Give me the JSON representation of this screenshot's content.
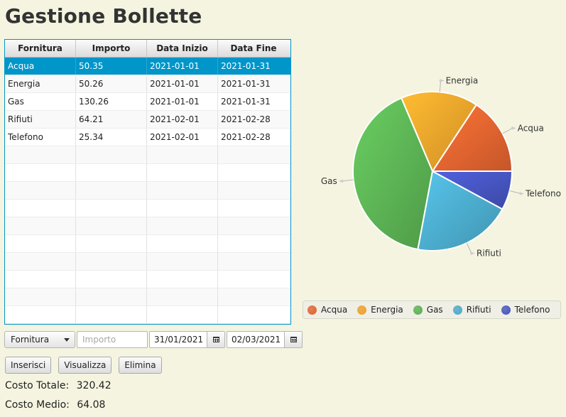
{
  "page": {
    "title": "Gestione Bollette"
  },
  "table": {
    "columns": [
      "Fornitura",
      "Importo",
      "Data Inizio",
      "Data Fine"
    ],
    "rows": [
      [
        "Acqua",
        "50.35",
        "2021-01-01",
        "2021-01-31"
      ],
      [
        "Energia",
        "50.26",
        "2021-01-01",
        "2021-01-31"
      ],
      [
        "Gas",
        "130.26",
        "2021-01-01",
        "2021-01-31"
      ],
      [
        "Rifiuti",
        "64.21",
        "2021-02-01",
        "2021-02-28"
      ],
      [
        "Telefono",
        "25.34",
        "2021-02-01",
        "2021-02-28"
      ]
    ],
    "selected_row": 0,
    "empty_rows": 11
  },
  "chart_data": {
    "type": "pie",
    "slices": [
      {
        "label": "Acqua",
        "value": 50.35,
        "color": "#e0622f"
      },
      {
        "label": "Energia",
        "value": 50.26,
        "color": "#eca02a"
      },
      {
        "label": "Gas",
        "value": 130.26,
        "color": "#5aaf52"
      },
      {
        "label": "Rifiuti",
        "value": 64.21,
        "color": "#4aa8c8"
      },
      {
        "label": "Telefono",
        "value": 25.34,
        "color": "#4453bc"
      }
    ],
    "legend": "bottom",
    "legend_entries": [
      "Acqua",
      "Energia",
      "Gas",
      "Rifiuti",
      "Telefono"
    ]
  },
  "form": {
    "combo_label": "Fornitura",
    "importo_placeholder": "Importo",
    "start_date": "31/01/2021",
    "end_date": "02/03/2021"
  },
  "buttons": {
    "insert": "Inserisci",
    "view": "Visualizza",
    "delete": "Elimina"
  },
  "stats": {
    "total_label": "Costo Totale:",
    "total_value": "320.42",
    "avg_label": "Costo Medio:",
    "avg_value": "64.08"
  },
  "icons": {
    "combo_arrow": "chevron-down-icon",
    "date_button": "calendar-icon"
  }
}
